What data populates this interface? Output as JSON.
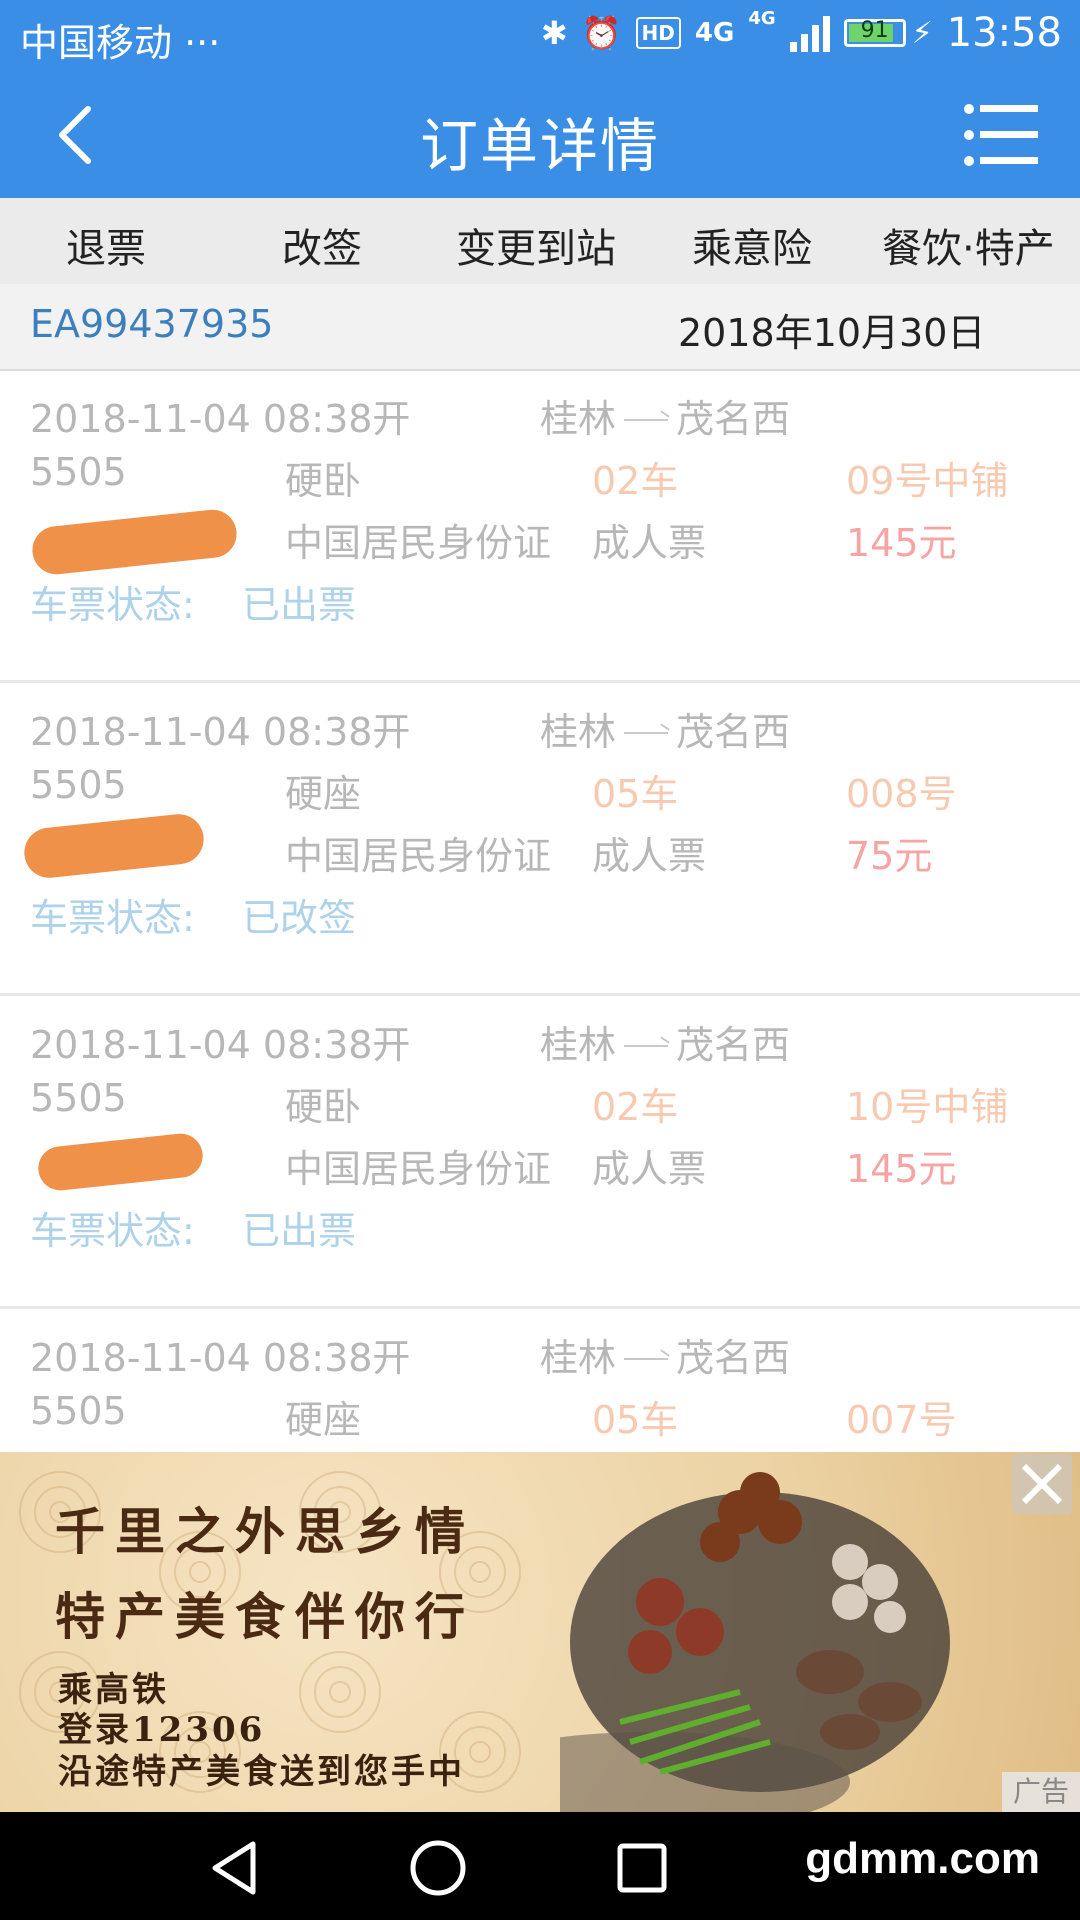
{
  "status_bar": {
    "carrier": "中国移动 ···",
    "hd": "HD",
    "signal_1": "4G",
    "signal_2": "4G",
    "battery": "91",
    "time": "13:58"
  },
  "header": {
    "title": "订单详情"
  },
  "tabs": [
    "退票",
    "改签",
    "变更到站",
    "乘意险",
    "餐饮·特产"
  ],
  "order": {
    "number": "EA99437935",
    "date": "2018年10月30日"
  },
  "tickets": [
    {
      "datetime": "2018-11-04  08:38开",
      "from": "桂林",
      "to": "茂名西",
      "train": "5505",
      "seat_class": "硬卧",
      "car": "02车",
      "seat": "09号中铺",
      "id_type": "中国居民身份证",
      "ticket_type": "成人票",
      "price": "145元",
      "status_label": "车票状态:",
      "status": "已出票"
    },
    {
      "datetime": "2018-11-04  08:38开",
      "from": "桂林",
      "to": "茂名西",
      "train": "5505",
      "seat_class": "硬座",
      "car": "05车",
      "seat": "008号",
      "id_type": "中国居民身份证",
      "ticket_type": "成人票",
      "price": "75元",
      "status_label": "车票状态:",
      "status": "已改签"
    },
    {
      "datetime": "2018-11-04  08:38开",
      "from": "桂林",
      "to": "茂名西",
      "train": "5505",
      "seat_class": "硬卧",
      "car": "02车",
      "seat": "10号中铺",
      "id_type": "中国居民身份证",
      "ticket_type": "成人票",
      "price": "145元",
      "status_label": "车票状态:",
      "status": "已出票"
    },
    {
      "datetime": "2018-11-04  08:38开",
      "from": "桂林",
      "to": "茂名西",
      "train": "5505",
      "seat_class": "硬座",
      "car": "05车",
      "seat": "007号"
    }
  ],
  "ad": {
    "line1": "千里之外思乡情",
    "line2": "特产美食伴你行",
    "line3": "乘高铁",
    "line4": "登录12306",
    "line5": "沿途特产美食送到您手中",
    "tag": "广告"
  },
  "watermark": "gdmm.com",
  "colors": {
    "header_blue": "#3a8ee6",
    "order_no_blue": "#3b7fbd",
    "seat_orange": "#f7c9b0",
    "price_pink": "#f7a4a4",
    "status_blue": "#aed2ea",
    "redaction_orange": "#f0914a"
  },
  "icons": {
    "back": "chevron-left-icon",
    "menu": "menu-icon",
    "close": "close-icon",
    "nav_back": "triangle-back-icon",
    "nav_home": "circle-home-icon",
    "nav_recent": "square-recent-icon"
  }
}
